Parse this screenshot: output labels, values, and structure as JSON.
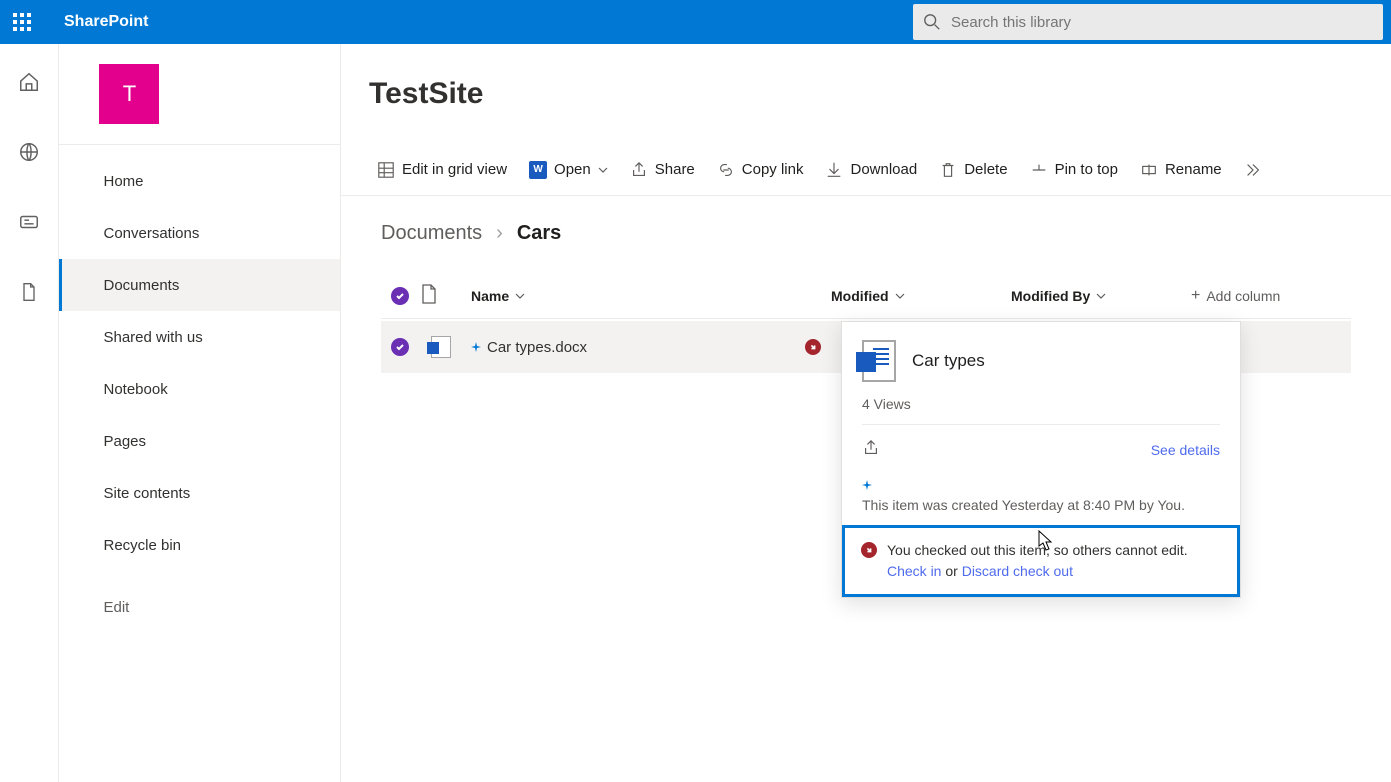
{
  "brand": "SharePoint",
  "search": {
    "placeholder": "Search this library"
  },
  "site": {
    "initial": "T",
    "name": "TestSite"
  },
  "nav": {
    "items": [
      "Home",
      "Conversations",
      "Documents",
      "Shared with us",
      "Notebook",
      "Pages",
      "Site contents",
      "Recycle bin"
    ],
    "edit": "Edit",
    "activeIndex": 2
  },
  "commands": {
    "edit_grid": "Edit in grid view",
    "open": "Open",
    "share": "Share",
    "copy_link": "Copy link",
    "download": "Download",
    "delete": "Delete",
    "pin": "Pin to top",
    "rename": "Rename"
  },
  "breadcrumb": {
    "parent": "Documents",
    "current": "Cars"
  },
  "columns": {
    "name": "Name",
    "modified": "Modified",
    "modified_by": "Modified By",
    "add": "Add column"
  },
  "row": {
    "file_name": "Car types.docx"
  },
  "card": {
    "title": "Car types",
    "views": "4 Views",
    "see_details": "See details",
    "created": "This item was created Yesterday at 8:40 PM by You.",
    "checkout_msg": "You checked out this item, so others cannot edit.",
    "check_in": "Check in",
    "or": " or ",
    "discard": "Discard check out"
  }
}
